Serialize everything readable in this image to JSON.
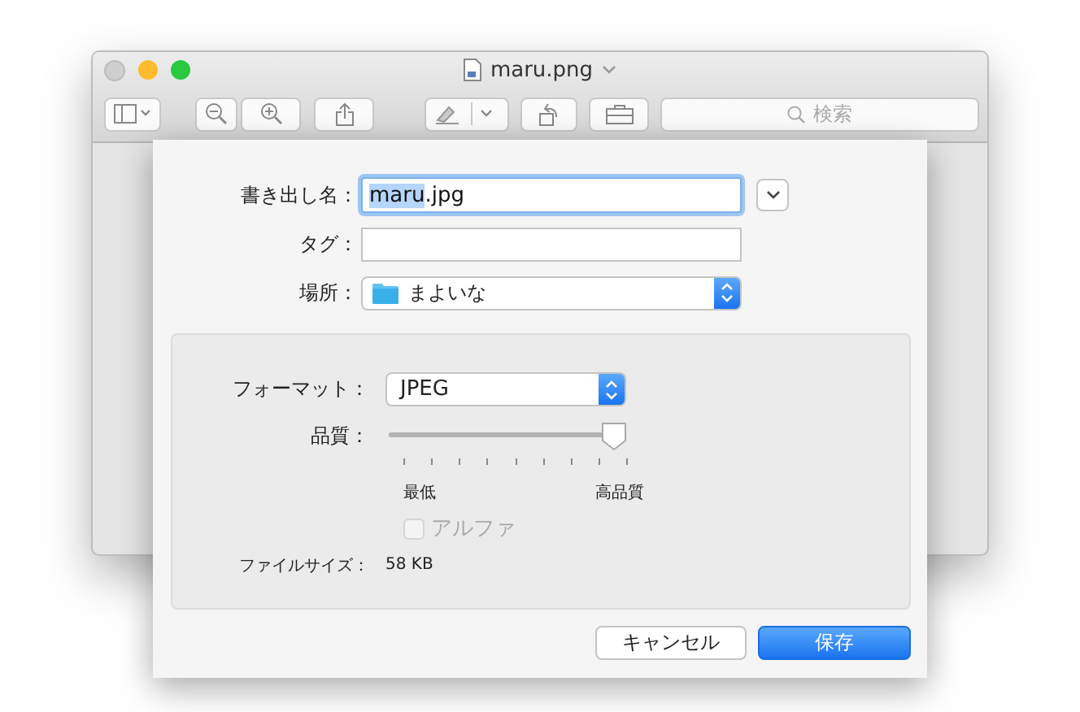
{
  "window": {
    "title": "maru.png",
    "search": {
      "placeholder": "検索"
    }
  },
  "sheet": {
    "filename": {
      "label": "書き出し名：",
      "selected_text": "maru",
      "rest": ".jpg",
      "expanded": false
    },
    "tags": {
      "label": "タグ："
    },
    "location": {
      "label": "場所：",
      "value": "まよいな"
    },
    "options": {
      "format": {
        "label": "フォーマット：",
        "value": "JPEG"
      },
      "quality": {
        "label": "品質：",
        "level": 1,
        "min_label": "最低",
        "max_label": "高品質"
      },
      "alpha": {
        "label": "アルファ",
        "checked": false,
        "disabled": true
      },
      "file_size": {
        "label": "ファイルサイズ：",
        "value": "58 KB"
      }
    },
    "buttons": [
      {
        "label": "キャンセル",
        "kind": "cancel"
      },
      {
        "label": "保存",
        "kind": "default"
      }
    ]
  }
}
